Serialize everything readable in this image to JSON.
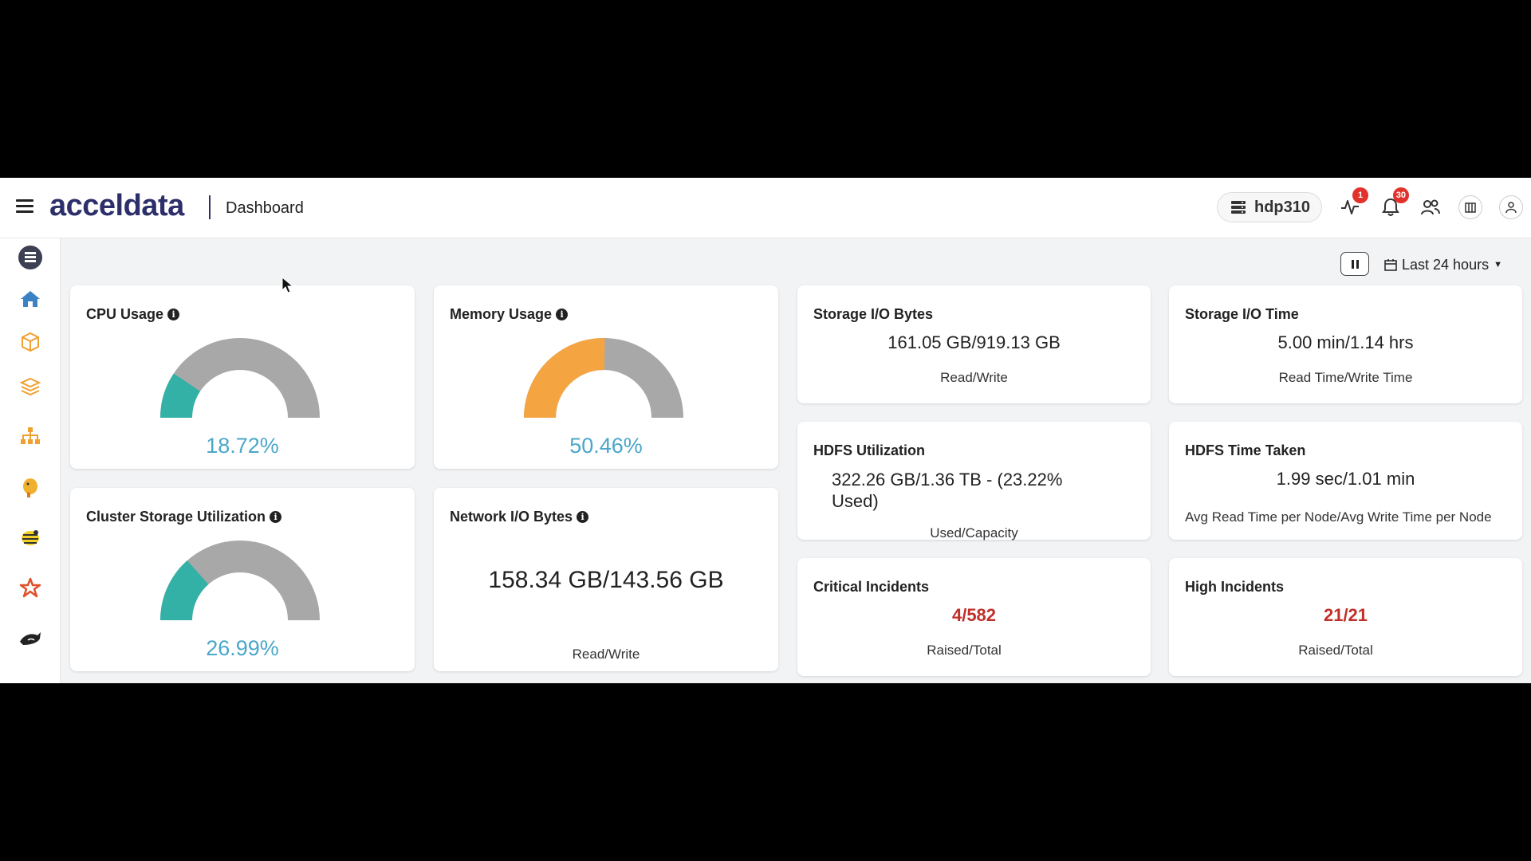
{
  "header": {
    "app_logo": "acceldata",
    "page_title": "Dashboard",
    "cluster_name": "hdp310",
    "alerts_badge": "1",
    "notifications_badge": "30"
  },
  "controls": {
    "time_range": "Last 24 hours"
  },
  "colors": {
    "gauge_teal": "#33b1a6",
    "gauge_orange": "#f5a442",
    "gauge_gray": "#a8a8a8",
    "value_blue": "#4aa7c9",
    "incident_red": "#c0302a",
    "brand_navy": "#2d2f6b"
  },
  "sidebar": {
    "items": [
      {
        "icon": "server-icon"
      },
      {
        "icon": "home-icon"
      },
      {
        "icon": "cube-icon"
      },
      {
        "icon": "layers-icon"
      },
      {
        "icon": "hierarchy-icon"
      },
      {
        "icon": "elephant-icon"
      },
      {
        "icon": "hive-icon"
      },
      {
        "icon": "spark-icon"
      },
      {
        "icon": "orca-icon"
      }
    ]
  },
  "cards": {
    "cpu": {
      "title": "CPU Usage",
      "value": "18.72%",
      "percent": 18.72
    },
    "memory": {
      "title": "Memory Usage",
      "value": "50.46%",
      "percent": 50.46
    },
    "cluster_storage": {
      "title": "Cluster Storage Utilization",
      "value": "26.99%",
      "percent": 26.99
    },
    "network_io": {
      "title": "Network I/O Bytes",
      "value": "158.34 GB/143.56 GB",
      "subtitle": "Read/Write"
    },
    "storage_io_bytes": {
      "title": "Storage I/O Bytes",
      "value": "161.05 GB/919.13 GB",
      "subtitle": "Read/Write"
    },
    "storage_io_time": {
      "title": "Storage I/O Time",
      "value": "5.00 min/1.14 hrs",
      "subtitle": "Read Time/Write Time"
    },
    "hdfs_util": {
      "title": "HDFS Utilization",
      "value": "322.26 GB/1.36 TB - (23.22% Used)",
      "subtitle": "Used/Capacity"
    },
    "hdfs_time": {
      "title": "HDFS Time Taken",
      "value": "1.99 sec/1.01 min",
      "subtitle": "Avg Read Time per Node/Avg Write Time per Node"
    },
    "critical": {
      "title": "Critical Incidents",
      "value": "4/582",
      "subtitle": "Raised/Total"
    },
    "high": {
      "title": "High Incidents",
      "value": "21/21",
      "subtitle": "Raised/Total"
    }
  }
}
